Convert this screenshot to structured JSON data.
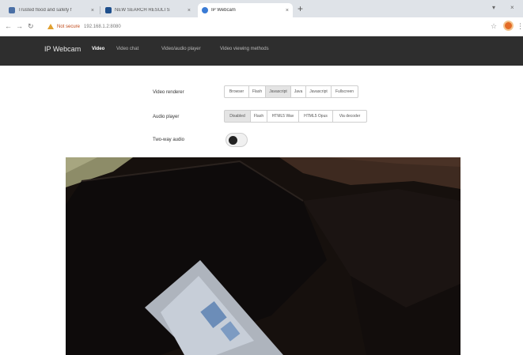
{
  "browser": {
    "tabs": [
      {
        "title": "Trusted flood and safety f",
        "active": false,
        "icon_color": "#4a6fa5"
      },
      {
        "title": "NEW SEARCH RESULTS",
        "active": false,
        "icon_color": "#1e4f8c"
      },
      {
        "title": "IP Webcam",
        "active": true,
        "icon_color": "#3a7bd5"
      }
    ],
    "address": {
      "security_label": "Not secure",
      "url": "192.168.1.2:8080"
    },
    "icons": [
      "back-icon",
      "forward-icon",
      "reload-icon",
      "star-icon",
      "menu-icon"
    ]
  },
  "app": {
    "brand": "IP Webcam",
    "nav": [
      {
        "label": "Video",
        "active": true
      },
      {
        "label": "Video chat",
        "active": false
      },
      {
        "label": "Video/audio player",
        "active": false
      },
      {
        "label": "Video viewing methods",
        "active": false
      }
    ]
  },
  "controls": {
    "video_renderer": {
      "label": "Video renderer",
      "options": [
        "Browser",
        "Flash",
        "Javascript",
        "Java",
        "Javascript",
        "Fullscreen"
      ],
      "selected_index": 2
    },
    "audio_player": {
      "label": "Audio player",
      "options": [
        "Disabled",
        "Flash",
        "HTML5 Wav",
        "HTML5 Opus",
        "Via decoder"
      ],
      "selected_index": 0
    },
    "two_way_audio": {
      "label": "Two-way audio",
      "enabled": false
    }
  },
  "colors": {
    "nav_bg": "#2e2e2e",
    "tabstrip_bg": "#dfe3e8",
    "selected_segment": "#e4e4e4",
    "insecure_warning": "#c04a1a"
  }
}
